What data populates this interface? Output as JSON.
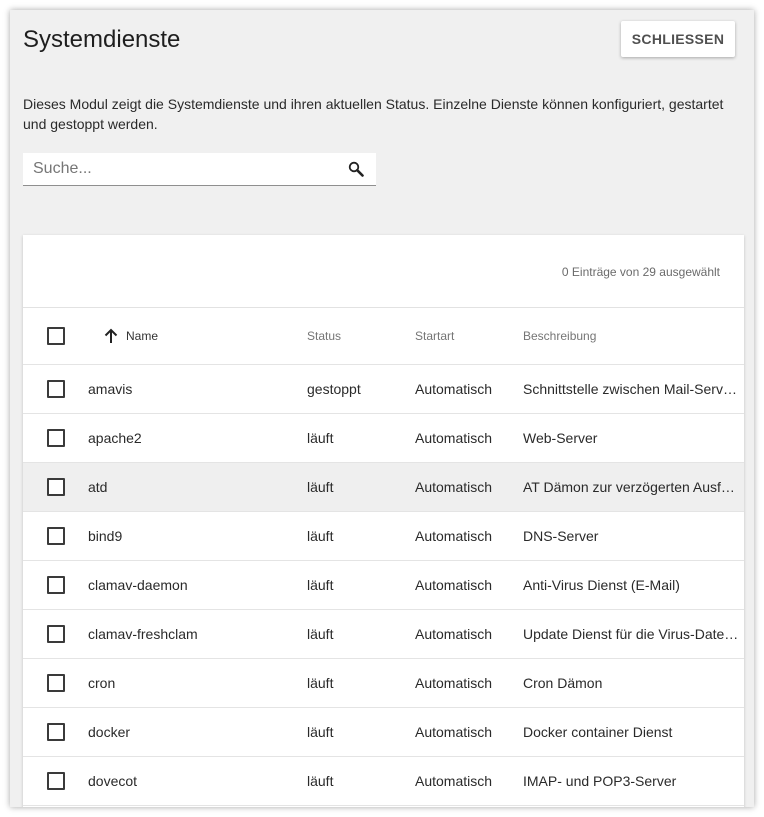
{
  "dialog": {
    "title": "Systemdienste",
    "close_label": "SCHLIESSEN",
    "description": "Dieses Modul zeigt die Systemdienste und ihren aktuellen Status. Einzelne Dienste können konfiguriert, gestartet und gestoppt werden.",
    "search": {
      "placeholder": "Suche...",
      "value": "",
      "icon": "search-icon"
    }
  },
  "grid": {
    "selected_count": "0 Einträge von 29 ausgewählt",
    "columns": {
      "name": "Name",
      "status": "Status",
      "startart": "Startart",
      "beschreibung": "Beschreibung"
    },
    "sort": {
      "column": "Name",
      "direction": "ascending",
      "icon": "arrow-up-icon"
    },
    "rows": [
      {
        "name": "amavis",
        "status": "gestoppt",
        "startart": "Automatisch",
        "beschreibung": "Schnittstelle zwischen Mail-Server und Virenscanner"
      },
      {
        "name": "apache2",
        "status": "läuft",
        "startart": "Automatisch",
        "beschreibung": "Web-Server"
      },
      {
        "name": "atd",
        "status": "läuft",
        "startart": "Automatisch",
        "beschreibung": "AT Dämon zur verzögerten Ausführung"
      },
      {
        "name": "bind9",
        "status": "läuft",
        "startart": "Automatisch",
        "beschreibung": "DNS-Server"
      },
      {
        "name": "clamav-daemon",
        "status": "läuft",
        "startart": "Automatisch",
        "beschreibung": "Anti-Virus Dienst (E-Mail)"
      },
      {
        "name": "clamav-freshclam",
        "status": "läuft",
        "startart": "Automatisch",
        "beschreibung": "Update Dienst für die Virus-Datenbank"
      },
      {
        "name": "cron",
        "status": "läuft",
        "startart": "Automatisch",
        "beschreibung": "Cron Dämon"
      },
      {
        "name": "docker",
        "status": "läuft",
        "startart": "Automatisch",
        "beschreibung": "Docker container Dienst"
      },
      {
        "name": "dovecot",
        "status": "läuft",
        "startart": "Automatisch",
        "beschreibung": "IMAP- und POP3-Server"
      }
    ]
  }
}
